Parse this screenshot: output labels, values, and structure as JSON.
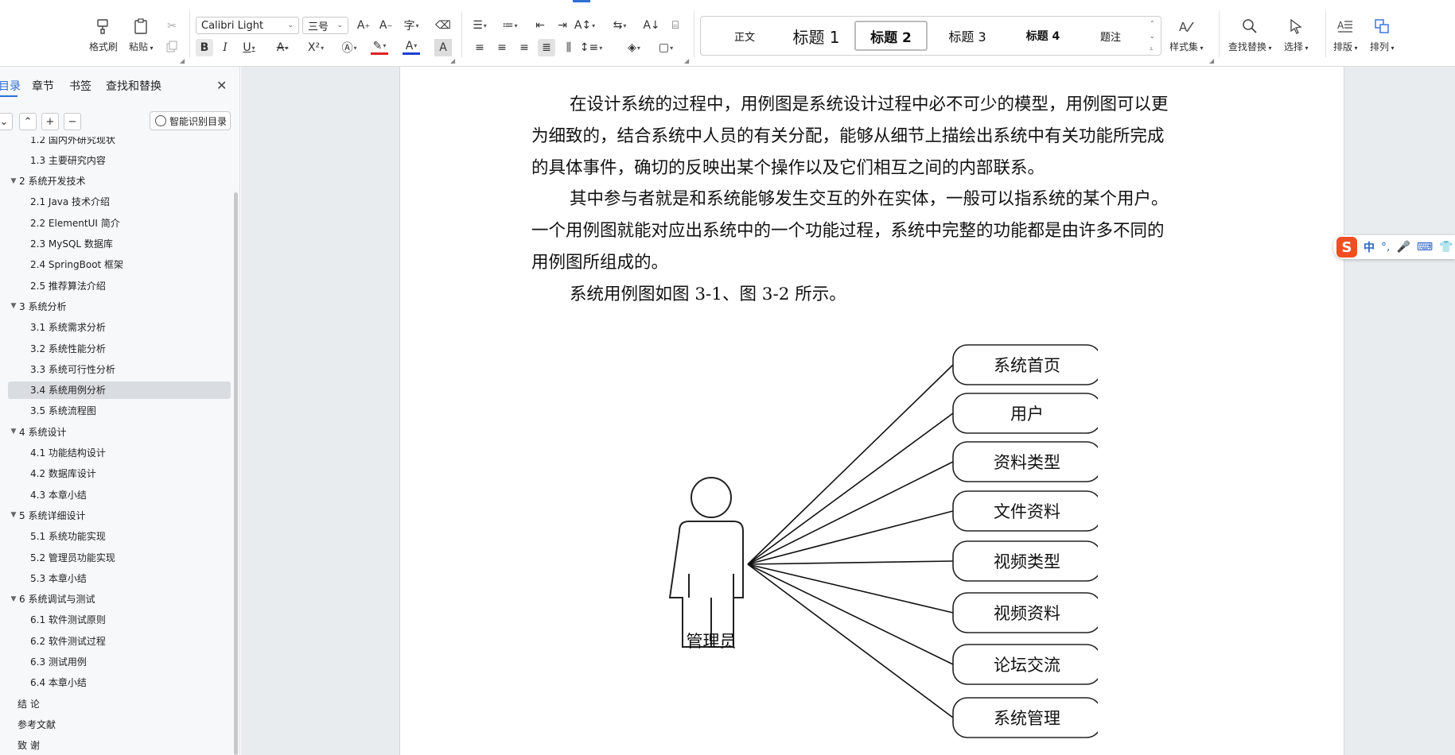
{
  "ribbon": {
    "format_painter": "格式刷",
    "paste": "粘贴",
    "font_name": "Calibri Light",
    "font_size": "三号",
    "styles": [
      "正文",
      "标题 1",
      "标题 2",
      "标题 3",
      "标题 4",
      "题注"
    ],
    "selected_style": "标题 2",
    "style_set": "样式集",
    "find_replace": "查找替换",
    "select": "选择",
    "typeset": "排版",
    "arrange": "排列"
  },
  "sidebar": {
    "tabs": [
      "目录",
      "章节",
      "书签",
      "查找和替换"
    ],
    "active_tab": "目录",
    "smart_toc": "智能识别目录",
    "toc": [
      {
        "label": "1.2 国内外研究现状",
        "level": 2
      },
      {
        "label": "1.3 主要研究内容",
        "level": 2
      },
      {
        "label": "2 系统开发技术",
        "level": 1
      },
      {
        "label": "2.1 Java 技术介绍",
        "level": 2
      },
      {
        "label": "2.2 ElementUI 简介",
        "level": 2
      },
      {
        "label": "2.3 MySQL 数据库",
        "level": 2
      },
      {
        "label": "2.4 SpringBoot 框架",
        "level": 2
      },
      {
        "label": "2.5 推荐算法介绍",
        "level": 2
      },
      {
        "label": "3 系统分析",
        "level": 1
      },
      {
        "label": "3.1 系统需求分析",
        "level": 2
      },
      {
        "label": "3.2 系统性能分析",
        "level": 2
      },
      {
        "label": "3.3 系统可行性分析",
        "level": 2
      },
      {
        "label": "3.4 系统用例分析",
        "level": 2,
        "selected": true
      },
      {
        "label": "3.5  系统流程图",
        "level": 2
      },
      {
        "label": "4  系统设计",
        "level": 1
      },
      {
        "label": "4.1 功能结构设计",
        "level": 2
      },
      {
        "label": "4.2 数据库设计",
        "level": 2
      },
      {
        "label": "4.3 本章小结",
        "level": 2
      },
      {
        "label": "5 系统详细设计",
        "level": 1
      },
      {
        "label": "5.1 系统功能实现",
        "level": 2
      },
      {
        "label": "5.2 管理员功能实现",
        "level": 2
      },
      {
        "label": "5.3 本章小结",
        "level": 2
      },
      {
        "label": "6  系统调试与测试",
        "level": 1
      },
      {
        "label": "6.1 软件测试原则",
        "level": 2
      },
      {
        "label": "6.2 软件测试过程",
        "level": 2
      },
      {
        "label": "6.3 测试用例",
        "level": 2
      },
      {
        "label": "6.4 本章小结",
        "level": 2
      },
      {
        "label": "结  论",
        "level": 0
      },
      {
        "label": "参考文献",
        "level": 0
      },
      {
        "label": "致  谢",
        "level": 0
      }
    ]
  },
  "document": {
    "paragraphs": [
      [
        "在设计系统的过程中，用例图是系统设计过程中必不可少的模型，用例图可以更",
        "为细致的，结合系统中人员的有关分配，能够从细节上描绘出系统中有关功能所完成",
        "的具体事件，确切的反映出某个操作以及它们相互之间的内部联系。"
      ],
      [
        "其中参与者就是和系统能够发生交互的外在实体，一般可以指系统的某个用户。",
        "一个用例图就能对应出系统中的一个功能过程，系统中完整的功能都是由许多不同的",
        "用例图所组成的。"
      ],
      [
        "系统用例图如图 3-1、图 3-2 所示。"
      ]
    ],
    "diagram": {
      "actor": "管理员",
      "use_cases": [
        "系统首页",
        "用户",
        "资料类型",
        "文件资料",
        "视频类型",
        "视频资料",
        "论坛交流",
        "系统管理"
      ]
    }
  },
  "ime": {
    "logo": "S",
    "mode": "中"
  },
  "colors": {
    "accent": "#2f6fd6",
    "selected_row": "#d9dde2",
    "ime_logo": "#f04e23"
  }
}
